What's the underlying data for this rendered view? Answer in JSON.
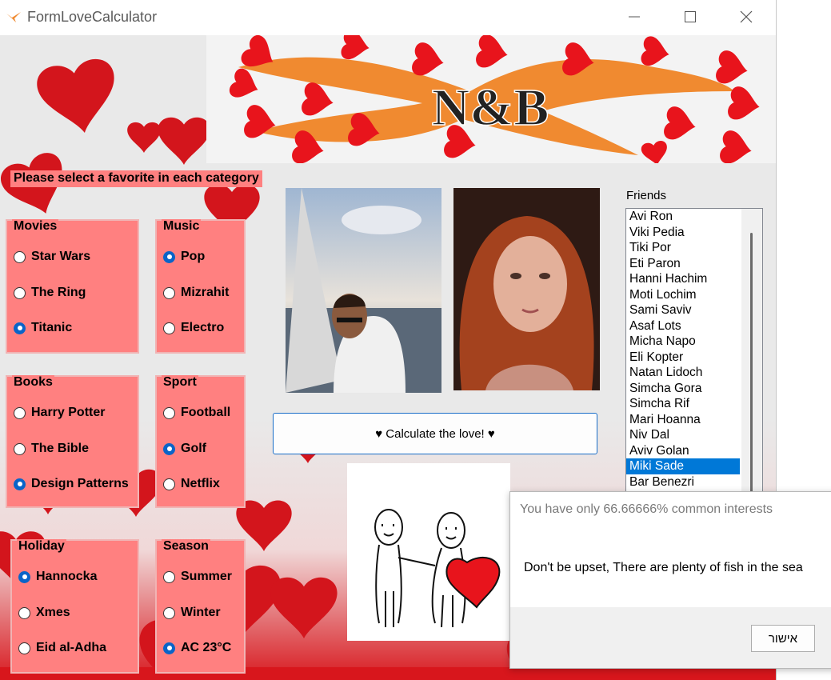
{
  "window": {
    "title": "FormLoveCalculator"
  },
  "banner": {
    "logo_text": "N&B"
  },
  "hint": "Please select a favorite in each category",
  "groups": {
    "movies": {
      "title": "Movies",
      "options": [
        "Star Wars",
        "The Ring",
        "Titanic"
      ],
      "selected": 2
    },
    "music": {
      "title": "Music",
      "options": [
        "Pop",
        "Mizrahit",
        "Electro"
      ],
      "selected": 0
    },
    "books": {
      "title": "Books",
      "options": [
        "Harry Potter",
        "The Bible",
        "Design Patterns"
      ],
      "selected": 2
    },
    "sport": {
      "title": "Sport",
      "options": [
        "Football",
        "Golf",
        "Netflix"
      ],
      "selected": 1
    },
    "holiday": {
      "title": "Holiday",
      "options": [
        "Hannocka",
        "Xmes",
        "Eid al-Adha"
      ],
      "selected": 0
    },
    "season": {
      "title": "Season",
      "options": [
        "Summer",
        "Winter",
        "AC 23°C"
      ],
      "selected": 2
    }
  },
  "calc_button": "♥ Calculate the love! ♥",
  "friends": {
    "label": "Friends",
    "items": [
      "Avi Ron",
      "Viki Pedia",
      "Tiki Por",
      "Eti Paron",
      "Hanni Hachim",
      "Moti Lochim",
      "Sami Saviv",
      "Asaf Lots",
      "Micha Napo",
      "Eli Kopter",
      "Natan Lidoch",
      "Simcha Gora",
      "Simcha Rif",
      "Mari Hoanna",
      "Niv Dal",
      "Aviv Golan",
      "Miki Sade",
      "Bar Benezri"
    ],
    "selected": 16
  },
  "messagebox": {
    "title": "You have only 66.66666% common interests",
    "text": "Don't be upset, There are plenty of fish in the sea",
    "ok": "אישור"
  },
  "colors": {
    "group_bg": "#ff8080",
    "heart": "#e8141c",
    "accent": "#0078d7",
    "banner_orange": "#f08a30"
  }
}
